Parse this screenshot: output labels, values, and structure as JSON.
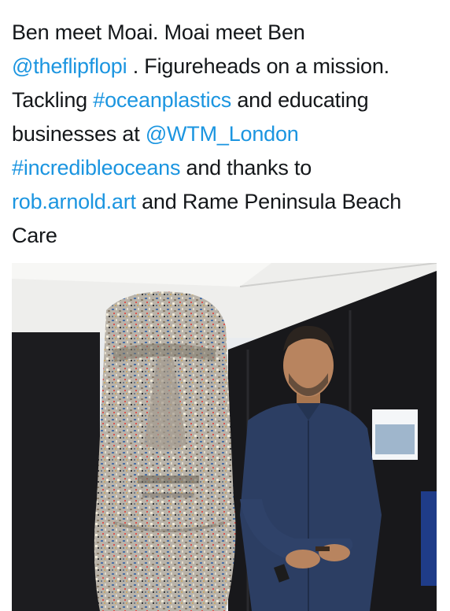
{
  "tweet": {
    "lines": [
      [
        {
          "t": "Ben meet Moai. Moai meet Ben",
          "link": false
        }
      ],
      [
        {
          "t": "@theflipflopi",
          "link": true
        },
        {
          "t": " . Figureheads on a mission.",
          "link": false
        }
      ],
      [
        {
          "t": "Tackling ",
          "link": false
        },
        {
          "t": "#oceanplastics",
          "link": true
        },
        {
          "t": " and educating",
          "link": false
        }
      ],
      [
        {
          "t": "businesses at ",
          "link": false
        },
        {
          "t": "@WTM_London",
          "link": true
        }
      ],
      [
        {
          "t": "#incredibleoceans",
          "link": true
        },
        {
          "t": " and thanks to",
          "link": false
        }
      ],
      [
        {
          "t": "rob.arnold.art",
          "link": true
        },
        {
          "t": " and Rame Peninsula Beach",
          "link": false
        }
      ],
      [
        {
          "t": "Care",
          "link": false
        }
      ]
    ]
  },
  "media": {
    "subject_left": "moai-statue-made-of-plastic-fragments",
    "subject_right": "man-in-navy-shirt",
    "colors": {
      "backdrop": "#1a1a1c",
      "ceiling": "#f2f2f0",
      "shirt": "#2c3e63",
      "skin": "#b8845f",
      "statue_base": "#b8b2a8"
    }
  },
  "colors": {
    "text": "#14171a",
    "link": "#1b95e0",
    "background": "#ffffff"
  }
}
